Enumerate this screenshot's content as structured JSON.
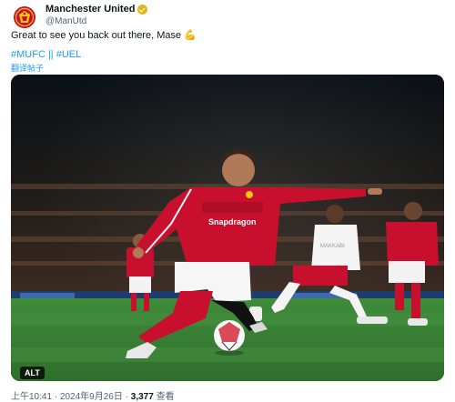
{
  "author": {
    "name": "Manchester United",
    "handle": "@ManUtd",
    "verified_color": "#e2b719"
  },
  "tweet": {
    "text": "Great to see you back out there, Mase 💪",
    "hashtags": [
      "#MUFC",
      "||",
      "#UEL"
    ],
    "translate_label": "翻译帖子",
    "image_alt_badge": "ALT",
    "sponsor_text": "Snapdragon",
    "opponent_kit_text": "MAKKABI"
  },
  "meta": {
    "time": "上午10:41",
    "separator": "·",
    "date": "2024年9月26日",
    "views_count": "3,377",
    "views_label": "查看"
  },
  "colors": {
    "link": "#1d9bf0",
    "secondary_text": "#536471",
    "united_red": "#c8102e"
  }
}
